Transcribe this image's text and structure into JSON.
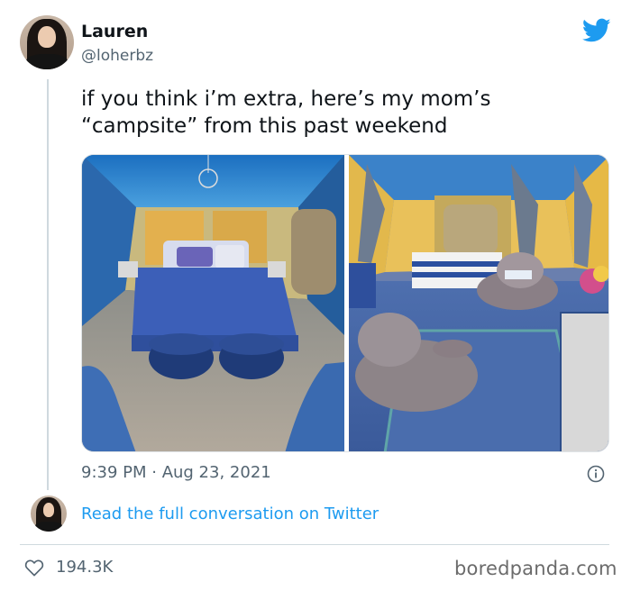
{
  "author": {
    "display_name": "Lauren",
    "handle": "@loherbz"
  },
  "tweet": {
    "text_line1": "if you think i’m extra, here’s my mom’s",
    "text_line2": "“campsite” from this past weekend",
    "timestamp": "9:39 PM · Aug 23, 2021",
    "likes": "194.3K"
  },
  "links": {
    "read_conversation": "Read the full conversation on Twitter"
  },
  "watermark": "boredpanda.com",
  "icons": {
    "brand": "twitter-bird-icon",
    "info": "info-icon",
    "like": "heart-icon"
  },
  "colors": {
    "twitter_blue": "#1d9bf0",
    "secondary_text": "#536471",
    "divider": "#cfd9de"
  }
}
